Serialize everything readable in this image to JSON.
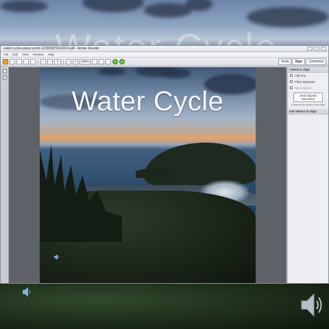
{
  "background": {
    "ghost_title": "Water Cycle"
  },
  "window": {
    "title": "water-cycle-power-point-1228098702208-9.pdf - Adobe Reader",
    "menu": [
      "File",
      "Edit",
      "View",
      "Window",
      "Help"
    ],
    "toolbar": {
      "page_number": "1",
      "zoom": "125%",
      "tabs": [
        "Tools",
        "Sign",
        "Comment"
      ],
      "active_tab": "Sign"
    }
  },
  "slide": {
    "title": "Water Cycle"
  },
  "right_pane": {
    "section_need_sign": "I Need to Sign",
    "items": [
      "Add Text",
      "Place Signature",
      "Send Signed"
    ],
    "send_button": "Send Signed Document",
    "powered_by": "Powered by Adobe EchoSign",
    "section_others": "Get Others to Sign"
  },
  "icons": {
    "slide_audio": "speaker-icon",
    "bottom_left_audio": "speaker-icon",
    "bottom_right_audio": "speaker-icon"
  }
}
